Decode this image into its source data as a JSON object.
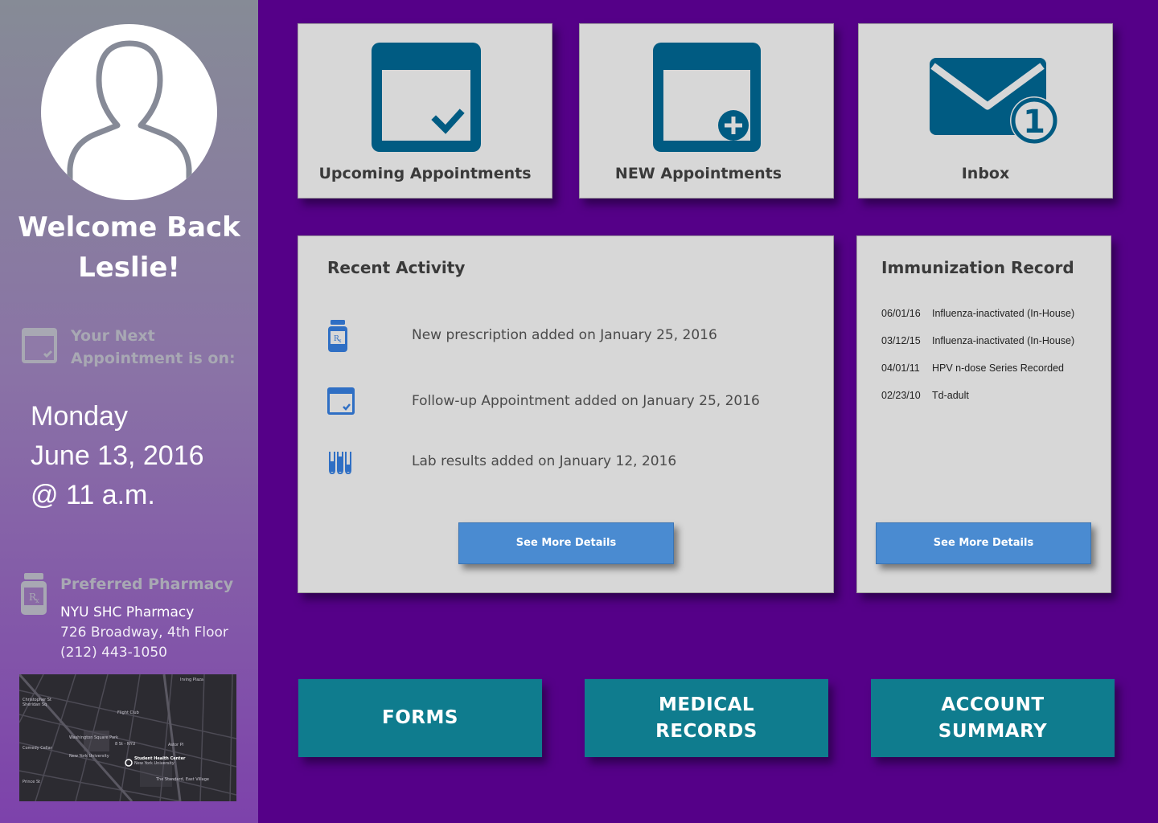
{
  "colors": {
    "background": "#550088",
    "card": "#d7d7d7",
    "icon_blue": "#005b82",
    "button_blue": "#4a8bd1",
    "button_teal": "#0f7c8e"
  },
  "sidebar": {
    "avatar_icon": "user-silhouette-icon",
    "welcome_line1": "Welcome Back",
    "welcome_line2": "Leslie!",
    "next_appt_label_line1": "Your Next",
    "next_appt_label_line2": "Appointment is on:",
    "next_appt_day": "Monday",
    "next_appt_date": "June 13, 2016",
    "next_appt_time": "@ 11 a.m.",
    "pharmacy_label": "Preferred Pharmacy",
    "pharmacy_name": "NYU SHC Pharmacy",
    "pharmacy_address": "726 Broadway, 4th Floor",
    "pharmacy_phone": "(212) 443-1050",
    "map": {
      "labels": {
        "christopher": "Christopher St",
        "sheridan": "Sheridan Sq",
        "flight": "Flight Club",
        "washington": "Washington Square Park",
        "nyu": "New York University",
        "shc": "Student Health Center",
        "shc2": "New York University",
        "astor": "Astor Pl",
        "standard": "The Standard, East Village",
        "irving": "Irving Plaza",
        "8st": "8 St - NYU",
        "prince": "Prince St",
        "cellar": "Comedy Cellar"
      }
    }
  },
  "tiles": {
    "upcoming": "Upcoming Appointments",
    "new": "NEW Appointments",
    "inbox": "Inbox",
    "inbox_badge": "1"
  },
  "recent": {
    "title": "Recent Activity",
    "items": [
      {
        "icon": "prescription-bottle-icon",
        "text": "New prescription added on January 25, 2016"
      },
      {
        "icon": "calendar-icon",
        "text": "Follow-up Appointment added on January 25, 2016"
      },
      {
        "icon": "test-tubes-icon",
        "text": "Lab results added on January 12, 2016"
      }
    ],
    "button": "See More Details"
  },
  "immunization": {
    "title": "Immunization Record",
    "rows": [
      {
        "date": "06/01/16",
        "vaccine": "Influenza-inactivated (In-House)"
      },
      {
        "date": "03/12/15",
        "vaccine": "Influenza-inactivated (In-House)"
      },
      {
        "date": "04/01/11",
        "vaccine": "HPV n-dose Series Recorded"
      },
      {
        "date": "02/23/10",
        "vaccine": "Td-adult"
      }
    ],
    "button": "See More Details"
  },
  "bottom_buttons": {
    "forms": "FORMS",
    "medical_line1": "MEDICAL",
    "medical_line2": "RECORDS",
    "account_line1": "ACCOUNT",
    "account_line2": "SUMMARY"
  }
}
